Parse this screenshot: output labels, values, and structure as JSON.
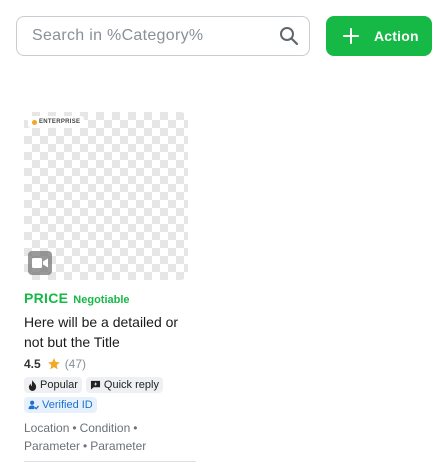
{
  "search": {
    "placeholder": "Search in %Category%",
    "value": ""
  },
  "action_button": {
    "label": "Action"
  },
  "card": {
    "enterprise_label": "ENTERPRISE",
    "price": "PRICE",
    "negotiable": "Negotiable",
    "title": "Here will be a  detailed or not but the Title",
    "rating": "4.5",
    "rating_count": "(47)",
    "badges": {
      "popular": "Popular",
      "quick_reply": "Quick reply",
      "verified": "Verified ID"
    },
    "params": [
      "Location",
      "Condition",
      "Parameter",
      "Parameter"
    ],
    "separator": "•"
  },
  "colors": {
    "accent": "#16b946",
    "verified": "#1d6fd1",
    "star": "#f0a825"
  },
  "icons": [
    "search-icon",
    "plus-icon",
    "video-icon",
    "star-icon",
    "fire-icon",
    "chat-icon",
    "person-check-icon"
  ]
}
